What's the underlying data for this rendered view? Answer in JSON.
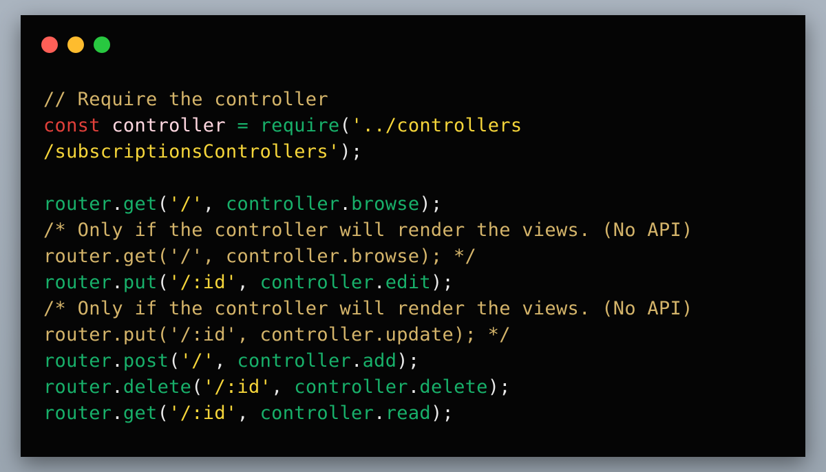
{
  "window": {
    "controls": [
      {
        "name": "close",
        "color": "#ff5f57"
      },
      {
        "name": "minimize",
        "color": "#febc2e"
      },
      {
        "name": "maximize",
        "color": "#28c840"
      }
    ]
  },
  "code": {
    "language": "javascript",
    "lines": [
      [
        {
          "t": "// Require the controller",
          "c": "comment"
        }
      ],
      [
        {
          "t": "const",
          "c": "kw"
        },
        {
          "t": " ",
          "c": "punc"
        },
        {
          "t": "controller",
          "c": "var"
        },
        {
          "t": " ",
          "c": "punc"
        },
        {
          "t": "=",
          "c": "op"
        },
        {
          "t": " ",
          "c": "punc"
        },
        {
          "t": "require",
          "c": "fn"
        },
        {
          "t": "(",
          "c": "punc"
        },
        {
          "t": "'../controllers",
          "c": "str"
        }
      ],
      [
        {
          "t": "/subscriptionsControllers'",
          "c": "str"
        },
        {
          "t": ");",
          "c": "punc"
        }
      ],
      [],
      [
        {
          "t": "router",
          "c": "fn"
        },
        {
          "t": ".",
          "c": "punc"
        },
        {
          "t": "get",
          "c": "fn"
        },
        {
          "t": "(",
          "c": "punc"
        },
        {
          "t": "'/'",
          "c": "str"
        },
        {
          "t": ", ",
          "c": "punc"
        },
        {
          "t": "controller",
          "c": "fn"
        },
        {
          "t": ".",
          "c": "punc"
        },
        {
          "t": "browse",
          "c": "fn"
        },
        {
          "t": ");",
          "c": "punc"
        }
      ],
      [
        {
          "t": "/* Only if the controller will render the views. (No API)",
          "c": "comment"
        }
      ],
      [
        {
          "t": "router.get('/', controller.browse); */",
          "c": "comment"
        }
      ],
      [
        {
          "t": "router",
          "c": "fn"
        },
        {
          "t": ".",
          "c": "punc"
        },
        {
          "t": "put",
          "c": "fn"
        },
        {
          "t": "(",
          "c": "punc"
        },
        {
          "t": "'/:id'",
          "c": "str"
        },
        {
          "t": ", ",
          "c": "punc"
        },
        {
          "t": "controller",
          "c": "fn"
        },
        {
          "t": ".",
          "c": "punc"
        },
        {
          "t": "edit",
          "c": "fn"
        },
        {
          "t": ");",
          "c": "punc"
        }
      ],
      [
        {
          "t": "/* Only if the controller will render the views. (No API)",
          "c": "comment"
        }
      ],
      [
        {
          "t": "router.put('/:id', controller.update); */",
          "c": "comment"
        }
      ],
      [
        {
          "t": "router",
          "c": "fn"
        },
        {
          "t": ".",
          "c": "punc"
        },
        {
          "t": "post",
          "c": "fn"
        },
        {
          "t": "(",
          "c": "punc"
        },
        {
          "t": "'/'",
          "c": "str"
        },
        {
          "t": ", ",
          "c": "punc"
        },
        {
          "t": "controller",
          "c": "fn"
        },
        {
          "t": ".",
          "c": "punc"
        },
        {
          "t": "add",
          "c": "fn"
        },
        {
          "t": ");",
          "c": "punc"
        }
      ],
      [
        {
          "t": "router",
          "c": "fn"
        },
        {
          "t": ".",
          "c": "punc"
        },
        {
          "t": "delete",
          "c": "fn"
        },
        {
          "t": "(",
          "c": "punc"
        },
        {
          "t": "'/:id'",
          "c": "str"
        },
        {
          "t": ", ",
          "c": "punc"
        },
        {
          "t": "controller",
          "c": "fn"
        },
        {
          "t": ".",
          "c": "punc"
        },
        {
          "t": "delete",
          "c": "fn"
        },
        {
          "t": ");",
          "c": "punc"
        }
      ],
      [
        {
          "t": "router",
          "c": "fn"
        },
        {
          "t": ".",
          "c": "punc"
        },
        {
          "t": "get",
          "c": "fn"
        },
        {
          "t": "(",
          "c": "punc"
        },
        {
          "t": "'/:id'",
          "c": "str"
        },
        {
          "t": ", ",
          "c": "punc"
        },
        {
          "t": "controller",
          "c": "fn"
        },
        {
          "t": ".",
          "c": "punc"
        },
        {
          "t": "read",
          "c": "fn"
        },
        {
          "t": ");",
          "c": "punc"
        }
      ]
    ]
  }
}
